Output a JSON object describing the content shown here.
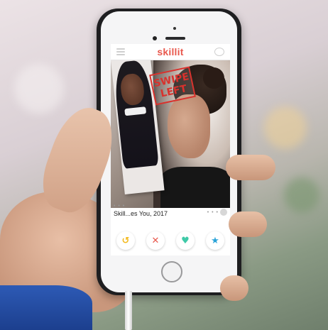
{
  "app": {
    "brand": "skillit",
    "icons": {
      "menu": "hamburger-menu-icon",
      "chat": "chat-bubble-icon"
    }
  },
  "card": {
    "stamp_line1": "SWIPE",
    "stamp_line2": "LEFT",
    "caption": "Skill...es You, 2017",
    "more_dots": "• • •"
  },
  "actions": [
    {
      "name": "undo",
      "glyph": "↺",
      "color": "#f3b91d"
    },
    {
      "name": "dislike",
      "glyph": "✕",
      "color": "#e8584d"
    },
    {
      "name": "like",
      "glyph": "♥",
      "color": "#3ec9a7"
    },
    {
      "name": "superlike",
      "glyph": "★",
      "color": "#2aa3d8"
    }
  ],
  "colors": {
    "brand": "#e8584d",
    "stamp": "#d8322d"
  }
}
